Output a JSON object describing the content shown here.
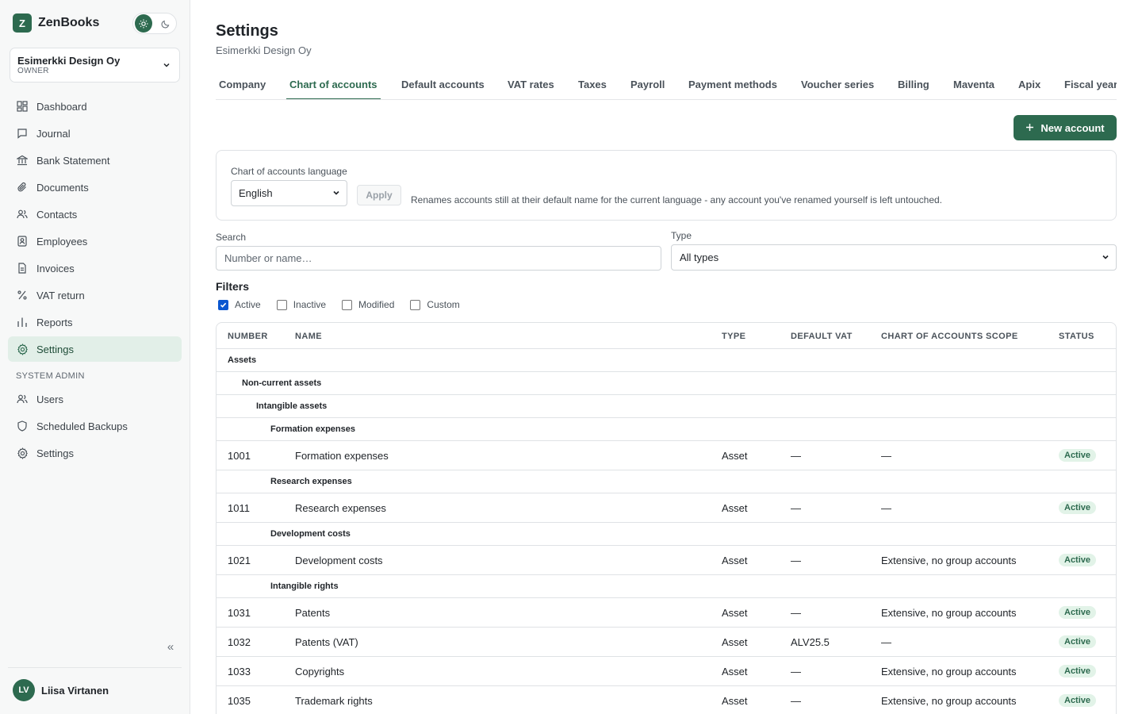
{
  "app": {
    "logo_letter": "Z",
    "name": "ZenBooks"
  },
  "org": {
    "name": "Esimerkki Design Oy",
    "role": "OWNER"
  },
  "nav": [
    {
      "label": "Dashboard",
      "icon": "dashboard-icon"
    },
    {
      "label": "Journal",
      "icon": "journal-icon"
    },
    {
      "label": "Bank Statement",
      "icon": "bank-icon"
    },
    {
      "label": "Documents",
      "icon": "paperclip-icon"
    },
    {
      "label": "Contacts",
      "icon": "contacts-icon"
    },
    {
      "label": "Employees",
      "icon": "employee-icon"
    },
    {
      "label": "Invoices",
      "icon": "invoice-icon"
    },
    {
      "label": "VAT return",
      "icon": "percent-icon"
    },
    {
      "label": "Reports",
      "icon": "bar-chart-icon"
    },
    {
      "label": "Settings",
      "icon": "gear-icon",
      "active": true
    }
  ],
  "admin_section": "SYSTEM ADMIN",
  "admin_nav": [
    {
      "label": "Users",
      "icon": "users-icon"
    },
    {
      "label": "Scheduled Backups",
      "icon": "shield-icon"
    },
    {
      "label": "Settings",
      "icon": "gear-icon"
    }
  ],
  "user": {
    "initials": "LV",
    "name": "Liisa Virtanen"
  },
  "page": {
    "title": "Settings",
    "subtitle": "Esimerkki Design Oy"
  },
  "tabs": [
    "Company",
    "Chart of accounts",
    "Default accounts",
    "VAT rates",
    "Taxes",
    "Payroll",
    "Payment methods",
    "Voucher series",
    "Billing",
    "Maventa",
    "Apix",
    "Fiscal year"
  ],
  "active_tab": "Chart of accounts",
  "new_account_label": "New account",
  "language": {
    "label": "Chart of accounts language",
    "value": "English",
    "apply_label": "Apply",
    "note": "Renames accounts still at their default name for the current language - any account you've renamed yourself is left untouched."
  },
  "search": {
    "label": "Search",
    "placeholder": "Number or name…"
  },
  "type_filter": {
    "label": "Type",
    "value": "All types"
  },
  "filters": {
    "title": "Filters",
    "items": [
      {
        "label": "Active",
        "checked": true
      },
      {
        "label": "Inactive",
        "checked": false
      },
      {
        "label": "Modified",
        "checked": false
      },
      {
        "label": "Custom",
        "checked": false
      }
    ]
  },
  "table": {
    "headers": [
      "NUMBER",
      "NAME",
      "TYPE",
      "DEFAULT VAT",
      "CHART OF ACCOUNTS SCOPE",
      "STATUS"
    ],
    "rows": [
      {
        "kind": "group",
        "level": 0,
        "label": "Assets"
      },
      {
        "kind": "group",
        "level": 1,
        "label": "Non-current assets"
      },
      {
        "kind": "group",
        "level": 2,
        "label": "Intangible assets"
      },
      {
        "kind": "group",
        "level": 3,
        "label": "Formation expenses"
      },
      {
        "kind": "account",
        "number": "1001",
        "name": "Formation expenses",
        "type": "Asset",
        "vat": "—",
        "scope": "—",
        "status": "Active"
      },
      {
        "kind": "group",
        "level": 3,
        "label": "Research expenses"
      },
      {
        "kind": "account",
        "number": "1011",
        "name": "Research expenses",
        "type": "Asset",
        "vat": "—",
        "scope": "—",
        "status": "Active"
      },
      {
        "kind": "group",
        "level": 3,
        "label": "Development costs"
      },
      {
        "kind": "account",
        "number": "1021",
        "name": "Development costs",
        "type": "Asset",
        "vat": "—",
        "scope": "Extensive, no group accounts",
        "status": "Active"
      },
      {
        "kind": "group",
        "level": 3,
        "label": "Intangible rights"
      },
      {
        "kind": "account",
        "number": "1031",
        "name": "Patents",
        "type": "Asset",
        "vat": "—",
        "scope": "Extensive, no group accounts",
        "status": "Active"
      },
      {
        "kind": "account",
        "number": "1032",
        "name": "Patents (VAT)",
        "type": "Asset",
        "vat": "ALV25.5",
        "scope": "—",
        "status": "Active"
      },
      {
        "kind": "account",
        "number": "1033",
        "name": "Copyrights",
        "type": "Asset",
        "vat": "—",
        "scope": "Extensive, no group accounts",
        "status": "Active"
      },
      {
        "kind": "account",
        "number": "1035",
        "name": "Trademark rights",
        "type": "Asset",
        "vat": "—",
        "scope": "Extensive, no group accounts",
        "status": "Active"
      }
    ]
  },
  "colors": {
    "brand": "#2d6a4f",
    "active_nav_bg": "#e2efe8",
    "badge_bg": "#e2f3e8"
  }
}
